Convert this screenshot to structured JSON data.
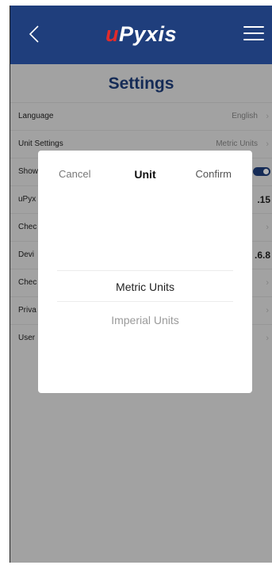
{
  "header": {
    "logo_u": "u",
    "logo_rest": "Pyxis"
  },
  "page_title": "Settings",
  "rows": [
    {
      "label": "Language",
      "value": "English"
    },
    {
      "label": "Unit Settings",
      "value": "Metric Units"
    },
    {
      "label": "Show"
    },
    {
      "label": "uPyx",
      "value": ".15"
    },
    {
      "label": "Chec"
    },
    {
      "label": "Devi",
      "value": ".6.8"
    },
    {
      "label": "Chec"
    },
    {
      "label": "Priva"
    },
    {
      "label": "User"
    }
  ],
  "dialog": {
    "cancel": "Cancel",
    "title": "Unit",
    "confirm": "Confirm",
    "options": [
      "Metric Units",
      "Imperial Units"
    ],
    "selected": "Metric Units"
  },
  "colors": {
    "navbar": "#1f3e7c",
    "logo_u": "#e02b2b",
    "title": "#1f3e7c"
  }
}
